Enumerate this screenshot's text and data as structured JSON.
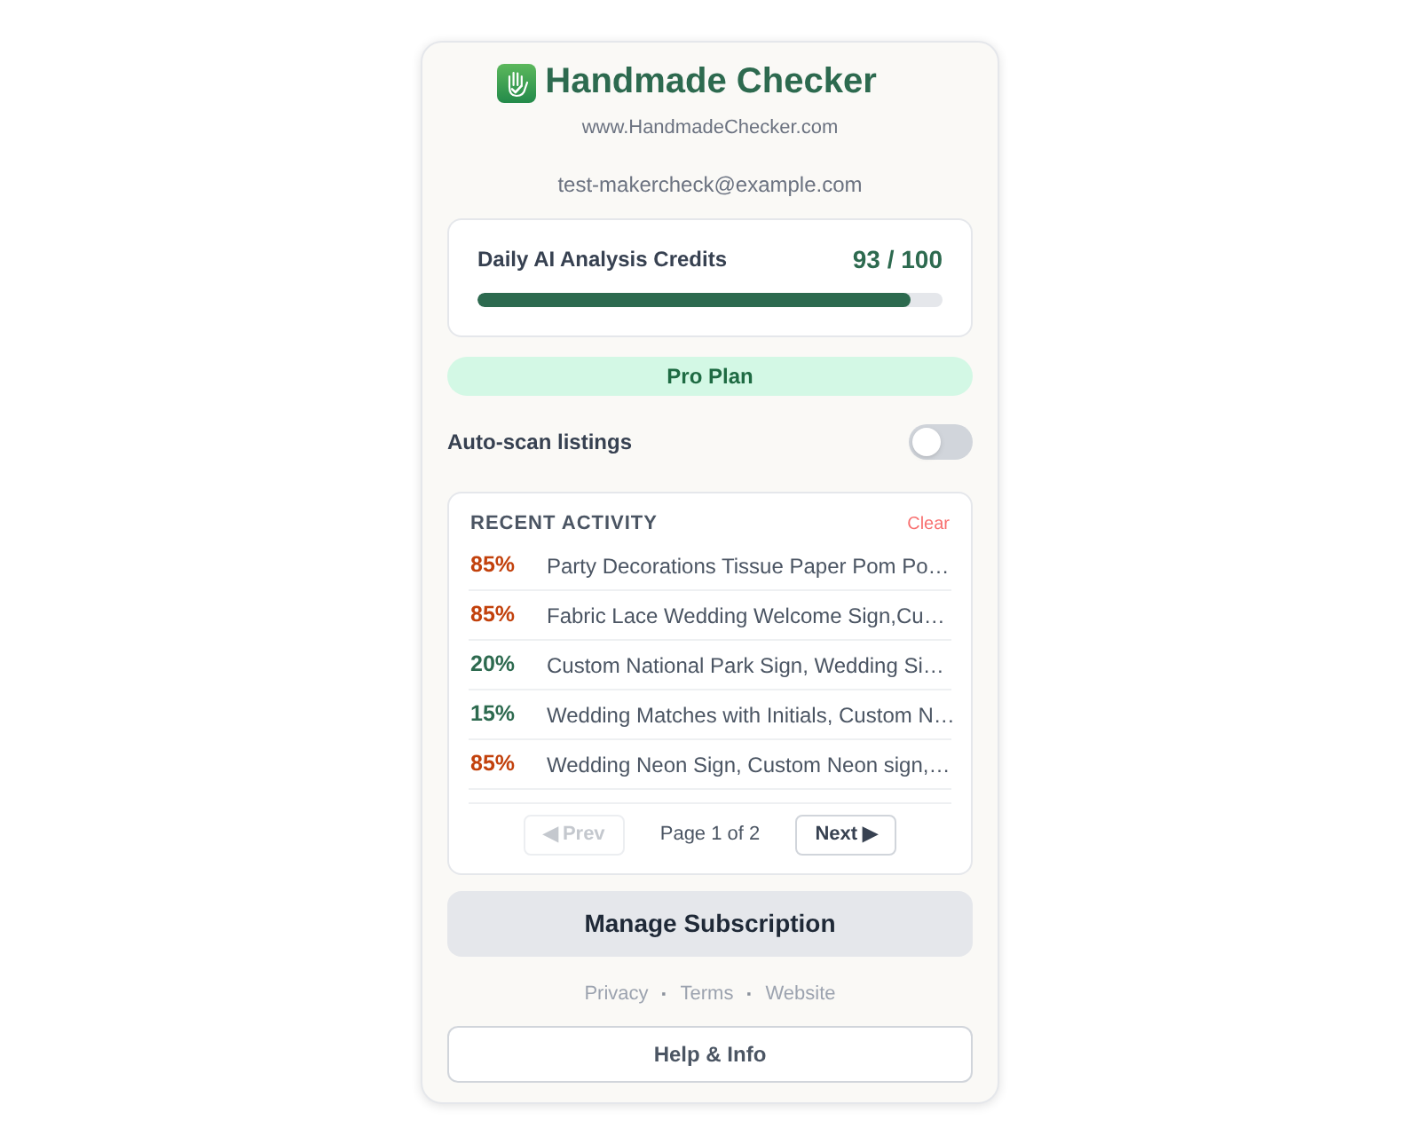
{
  "header": {
    "title": "Handmade Checker",
    "website": "www.HandmadeChecker.com"
  },
  "account": {
    "email": "test-makercheck@example.com"
  },
  "credits": {
    "label": "Daily AI Analysis Credits",
    "reading": "93 / 100",
    "level": 0.93
  },
  "plan": {
    "label": "Pro Plan"
  },
  "auto_scan": {
    "label": "Auto-scan listings",
    "on": false
  },
  "recent_activity": {
    "title": "RECENT ACTIVITY",
    "clear": "Clear",
    "items": [
      {
        "score": "85%",
        "color": "#c2410c",
        "title": "Party Decorations Tissue Paper Pom Po…"
      },
      {
        "score": "85%",
        "color": "#c2410c",
        "title": "Fabric Lace Wedding Welcome Sign,Cu…"
      },
      {
        "score": "20%",
        "color": "#2d6a4f",
        "title": "Custom National Park Sign, Wedding Si…"
      },
      {
        "score": "15%",
        "color": "#2d6a4f",
        "title": "Wedding Matches with Initials, Custom N…"
      },
      {
        "score": "85%",
        "color": "#c2410c",
        "title": "Wedding Neon Sign, Custom Neon sign,…"
      }
    ],
    "pagination": {
      "prev": {
        "label": "◀ Prev",
        "disabled": true
      },
      "page": "Page 1 of 2",
      "next": {
        "label": "Next ▶",
        "disabled": false
      }
    }
  },
  "manage_button": "Manage Subscription",
  "footer_links": {
    "links": [
      "Privacy",
      "Terms",
      "Website"
    ],
    "separator": "·"
  },
  "help_button": "Help & Info"
}
